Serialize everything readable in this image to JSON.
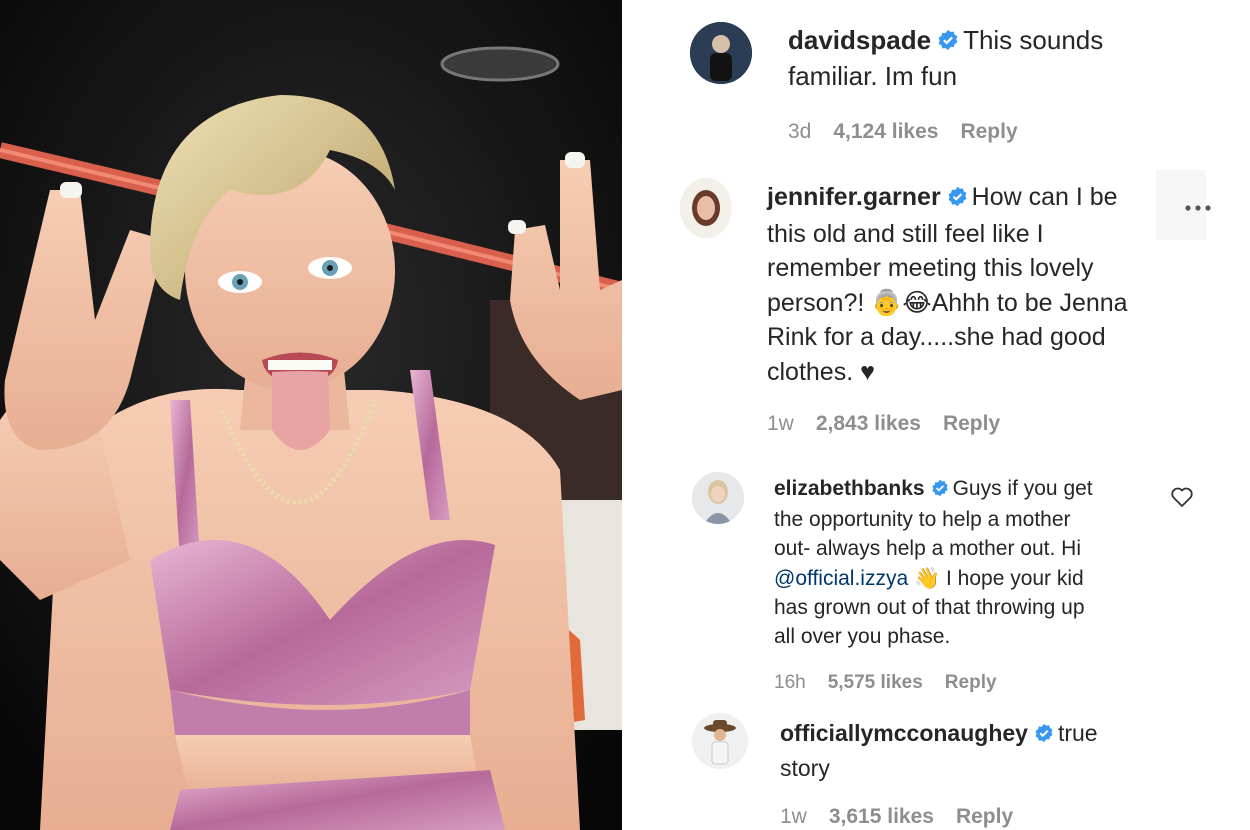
{
  "comments": [
    {
      "username": "davidspade",
      "text_lines": [
        "This sounds",
        "familiar. Im fun"
      ],
      "time": "3d",
      "likes": "4,124 likes",
      "reply": "Reply"
    },
    {
      "username": "jennifer.garner",
      "text_lines": [
        "How can I be",
        "this old and still feel like I",
        "remember meeting this lovely",
        "person?! 👵😂Ahhh to be Jenna",
        "Rink for a day.....she had good",
        "clothes. ♥"
      ],
      "time": "1w",
      "likes": "2,843 likes",
      "reply": "Reply"
    },
    {
      "username": "elizabethbanks",
      "text_first": "Guys if you get",
      "text_lines": [
        "the opportunity to help a mother",
        "out- always help a mother out. Hi"
      ],
      "mention": "@official.izzya",
      "mention_suffix": "👋 I hope your kid",
      "text_tail": [
        "has grown out of that throwing up",
        "all over you phase."
      ],
      "time": "16h",
      "likes": "5,575 likes",
      "reply": "Reply"
    },
    {
      "username": "officiallymcconaughey",
      "text_lines": [
        "true",
        "story"
      ],
      "time": "1w",
      "likes": "3,615 likes",
      "reply": "Reply"
    }
  ],
  "colors": {
    "verified": "#3897f0",
    "meta": "#8e8e8e",
    "mention": "#00376b",
    "text": "#262626"
  },
  "icons": [
    "verified-badge-icon",
    "heart-icon",
    "more-options-icon"
  ]
}
